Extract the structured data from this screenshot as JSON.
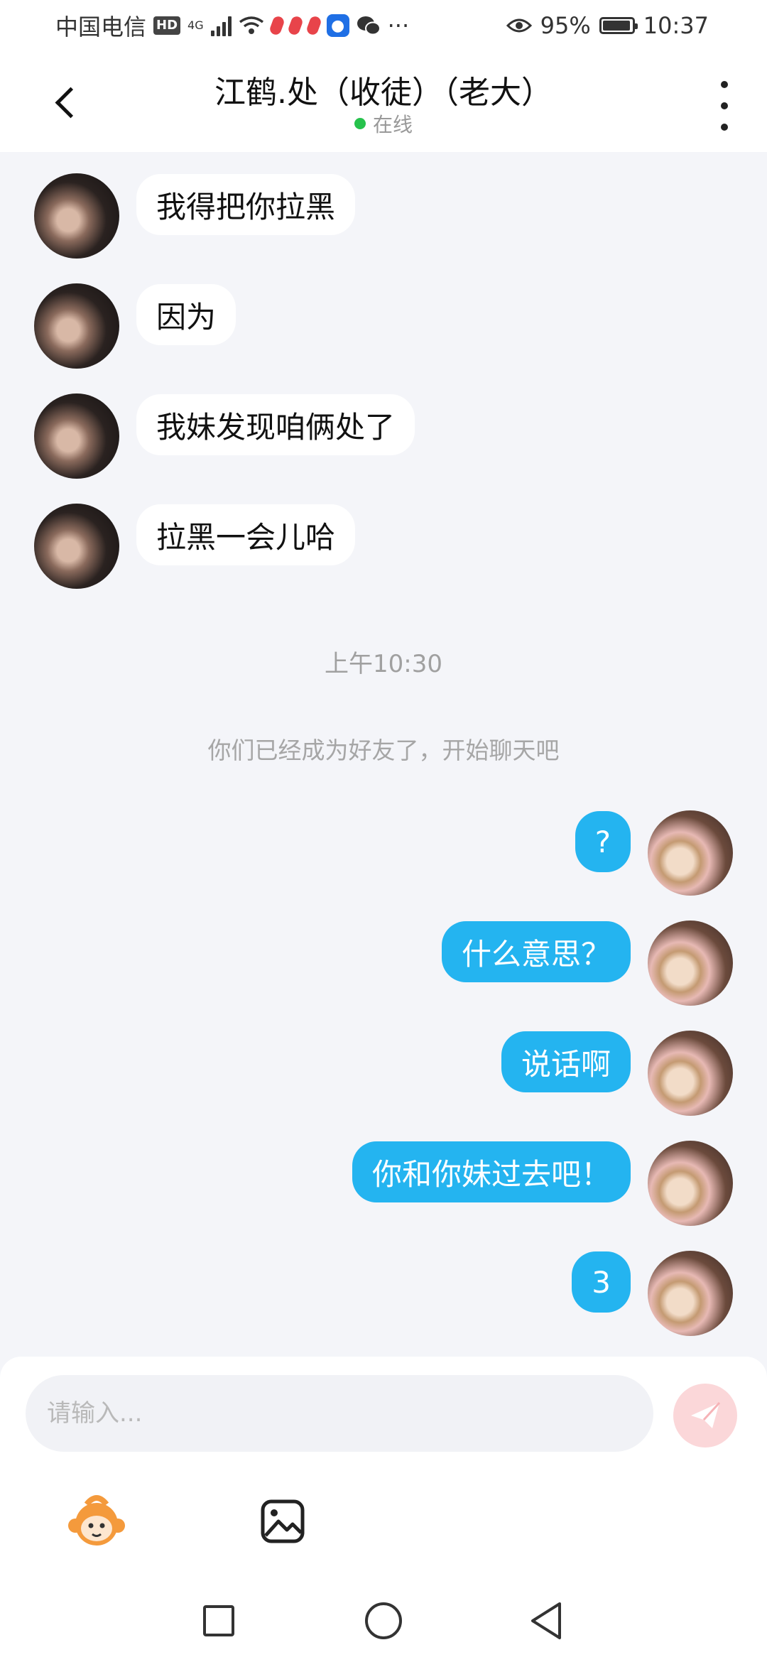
{
  "status_bar": {
    "carrier": "中国电信",
    "hd": "HD",
    "network": "4G",
    "battery": "95%",
    "time": "10:37",
    "more": "···"
  },
  "header": {
    "title": "江鹤.处（收徒）（老大）",
    "status": "在线"
  },
  "messages_in": [
    {
      "text": "我得把你拉黑"
    },
    {
      "text": "因为"
    },
    {
      "text": "我妹发现咱俩处了"
    },
    {
      "text": "拉黑一会儿哈"
    }
  ],
  "time_divider": "上午10:30",
  "system_notice": "你们已经成为好友了，开始聊天吧",
  "messages_out": [
    {
      "text": "?"
    },
    {
      "text": "什么意思？"
    },
    {
      "text": "说话啊"
    },
    {
      "text": "你和你妹过去吧！"
    },
    {
      "text": "3"
    }
  ],
  "composer": {
    "placeholder": "请输入..."
  },
  "colors": {
    "accent_blue": "#24b4f0",
    "online_green": "#26c24c",
    "send_button": "#fbd7d9"
  },
  "icons": [
    "back-icon",
    "more-icon",
    "send-icon",
    "emoji-icon",
    "image-icon",
    "wifi-icon",
    "battery-icon",
    "eye-icon"
  ]
}
